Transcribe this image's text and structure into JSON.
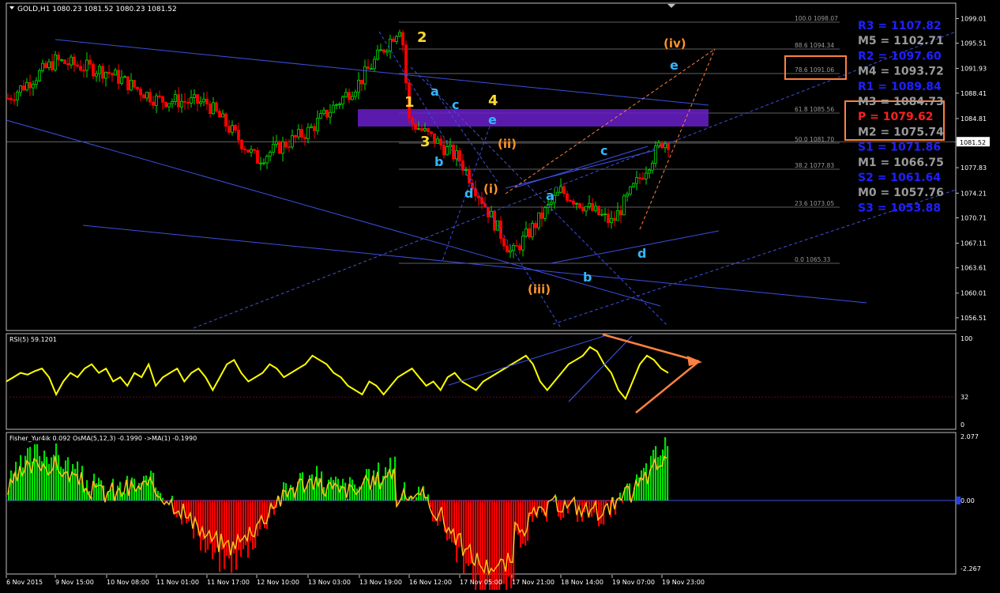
{
  "window": {
    "symbol_header": "GOLD,H1  1080.23 1081.52 1080.23 1081.52"
  },
  "colors": {
    "bg": "#000000",
    "frame": "#c0c0c0",
    "grid": "#404040",
    "bull": "#00e000",
    "bear": "#ff0000",
    "trend": "#3c50e0",
    "fib": "#7f7f7f",
    "zone": "#6a1fc9",
    "rsi": "#ffff00",
    "orange": "#ff8040",
    "wave_yellow": "#ffd830",
    "wave_cyan": "#33b7ff",
    "wave_orange": "#ff9326",
    "pivot_blue": "#2020ff",
    "pivot_gray": "#9a9a9a",
    "pivot_red": "#ff2020"
  },
  "price_axis": {
    "ticks": [
      "1099.01",
      "1095.51",
      "1091.93",
      "1088.41",
      "1084.81",
      "1081.52",
      "1077.83",
      "1074.21",
      "1070.71",
      "1067.11",
      "1063.61",
      "1060.01",
      "1056.51"
    ],
    "current": "1081.52"
  },
  "time_axis": {
    "ticks": [
      "6 Nov 2015",
      "9 Nov 15:00",
      "10 Nov 08:00",
      "11 Nov 01:00",
      "11 Nov 17:00",
      "12 Nov 10:00",
      "13 Nov 03:00",
      "13 Nov 19:00",
      "16 Nov 12:00",
      "17 Nov 05:00",
      "17 Nov 21:00",
      "18 Nov 14:00",
      "19 Nov 07:00",
      "19 Nov 23:00"
    ]
  },
  "fib_levels": [
    {
      "label": "100.0 1098.07"
    },
    {
      "label": "88.6 1094.34"
    },
    {
      "label": "78.6 1091.06"
    },
    {
      "label": "61.8 1085.56"
    },
    {
      "label": "50.0 1081.70"
    },
    {
      "label": "38.2 1077.83"
    },
    {
      "label": "23.6 1073.05"
    },
    {
      "label": "0.0 1065.33"
    }
  ],
  "pivots": [
    {
      "text": "R3 = 1107.82",
      "kind": "blue"
    },
    {
      "text": "M5 = 1102.71",
      "kind": "gray"
    },
    {
      "text": "R2 = 1097.60",
      "kind": "blue"
    },
    {
      "text": "M4 = 1093.72",
      "kind": "gray"
    },
    {
      "text": "R1 = 1089.84",
      "kind": "blue"
    },
    {
      "text": "M3 = 1084.73",
      "kind": "gray"
    },
    {
      "text": "P  = 1079.62",
      "kind": "red"
    },
    {
      "text": "M2 = 1075.74",
      "kind": "gray"
    },
    {
      "text": "S1 = 1071.86",
      "kind": "blue"
    },
    {
      "text": "M1 = 1066.75",
      "kind": "gray"
    },
    {
      "text": "S2 = 1061.64",
      "kind": "blue"
    },
    {
      "text": "M0 = 1057.76",
      "kind": "gray"
    },
    {
      "text": "S3 = 1053.88",
      "kind": "blue"
    }
  ],
  "wave_labels": [
    {
      "text": "2",
      "kind": "yellow"
    },
    {
      "text": "1",
      "kind": "yellow"
    },
    {
      "text": "3",
      "kind": "yellow"
    },
    {
      "text": "4",
      "kind": "yellow"
    },
    {
      "text": "a",
      "kind": "cyan"
    },
    {
      "text": "b",
      "kind": "cyan"
    },
    {
      "text": "c",
      "kind": "cyan"
    },
    {
      "text": "d",
      "kind": "cyan"
    },
    {
      "text": "e",
      "kind": "cyan"
    },
    {
      "text": "(i)",
      "kind": "orange"
    },
    {
      "text": "(ii)",
      "kind": "orange"
    },
    {
      "text": "(iii)",
      "kind": "orange"
    },
    {
      "text": "(iv)",
      "kind": "orange"
    },
    {
      "text": "a",
      "kind": "cyan"
    },
    {
      "text": "b",
      "kind": "cyan"
    },
    {
      "text": "c",
      "kind": "cyan"
    },
    {
      "text": "d",
      "kind": "cyan"
    },
    {
      "text": "e",
      "kind": "cyan"
    }
  ],
  "rsi": {
    "header": "RSI(5) 59.1201",
    "ticks": [
      "100",
      "32",
      "0"
    ],
    "level": 32
  },
  "fisher": {
    "header": "Fisher_Yur4ik 0.092  OsMA(5,12,3) -0.1990  ->MA(1) -0.1990",
    "ticks": [
      "2.077",
      "0.00",
      "-2.267"
    ]
  },
  "chart_data": [
    {
      "type": "candlestick",
      "title": "GOLD,H1",
      "ylim": [
        1054.7,
        1101.2
      ],
      "key_points": [
        {
          "x": "6 Nov 2015",
          "y": 1087.5
        },
        {
          "x": "9 Nov 15:00",
          "y": 1093.0
        },
        {
          "x": "10 Nov 08:00",
          "y": 1091.5
        },
        {
          "x": "11 Nov 01:00",
          "y": 1087.5
        },
        {
          "x": "11 Nov 17:00",
          "y": 1087.0
        },
        {
          "x": "12 Nov 10:00",
          "y": 1079.0
        },
        {
          "x": "13 Nov 03:00",
          "y": 1083.0
        },
        {
          "x": "13 Nov 19:00",
          "y": 1090.0
        },
        {
          "x": "16 Nov",
          "y": 1098.2
        },
        {
          "x": "16 Nov 12:00",
          "y": 1084.5
        },
        {
          "x": "17 Nov 05:00",
          "y": 1079.0
        },
        {
          "x": "17 Nov 21:00",
          "y": 1065.5
        },
        {
          "x": "18 Nov 14:00",
          "y": 1074.5
        },
        {
          "x": "19 Nov 07:00",
          "y": 1070.0
        },
        {
          "x": "19 Nov 23:00",
          "y": 1081.5
        }
      ]
    },
    {
      "type": "line",
      "title": "RSI(5) 59.1201",
      "ylim": [
        0,
        100
      ],
      "values": [
        50,
        55,
        60,
        58,
        62,
        65,
        55,
        35,
        50,
        60,
        55,
        65,
        70,
        60,
        65,
        50,
        55,
        45,
        60,
        55,
        70,
        45,
        55,
        60,
        65,
        50,
        60,
        65,
        55,
        40,
        55,
        70,
        75,
        60,
        50,
        55,
        60,
        70,
        65,
        55,
        60,
        65,
        70,
        80,
        75,
        70,
        60,
        55,
        45,
        40,
        35,
        50,
        45,
        35,
        45,
        55,
        60,
        65,
        55,
        45,
        50,
        40,
        55,
        60,
        50,
        45,
        40,
        50,
        55,
        60,
        65,
        70,
        75,
        80,
        70,
        50,
        40,
        50,
        60,
        70,
        75,
        80,
        90,
        85,
        70,
        60,
        40,
        30,
        50,
        70,
        80,
        75,
        65,
        60
      ]
    },
    {
      "type": "bar",
      "title": "Fisher_Yur4ik 0.092  OsMA(5,12,3) -0.1990",
      "ylim": [
        -2.267,
        2.077
      ]
    }
  ]
}
